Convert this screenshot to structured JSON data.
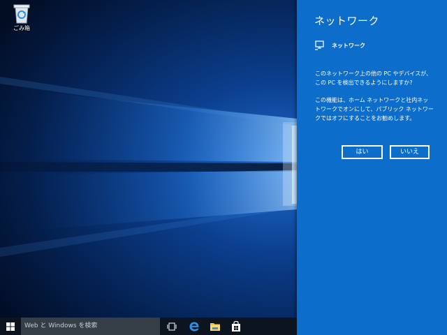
{
  "desktop": {
    "icons": [
      {
        "label": "ごみ箱",
        "icon": "recycle-bin-icon"
      }
    ]
  },
  "network_panel": {
    "title": "ネットワーク",
    "network_name": "ネットワーク",
    "network_icon": "network-icon",
    "question": "このネットワーク上の他の PC やデバイスが、この PC を検出できるようにしますか?",
    "explanation": "この機能は、ホーム ネットワークと社内ネットワークでオンにして、パブリック ネットワークではオフにすることをお勧めします。",
    "yes_label": "はい",
    "no_label": "いいえ",
    "background_color": "#0c6dcb"
  },
  "taskbar": {
    "start_icon": "windows-logo-icon",
    "search_placeholder": "Web と Windows を検索",
    "pinned": [
      {
        "name": "task-view",
        "icon": "task-view-icon"
      },
      {
        "name": "edge",
        "icon": "edge-icon"
      },
      {
        "name": "file-explorer",
        "icon": "folder-icon"
      },
      {
        "name": "store",
        "icon": "store-icon"
      }
    ]
  }
}
